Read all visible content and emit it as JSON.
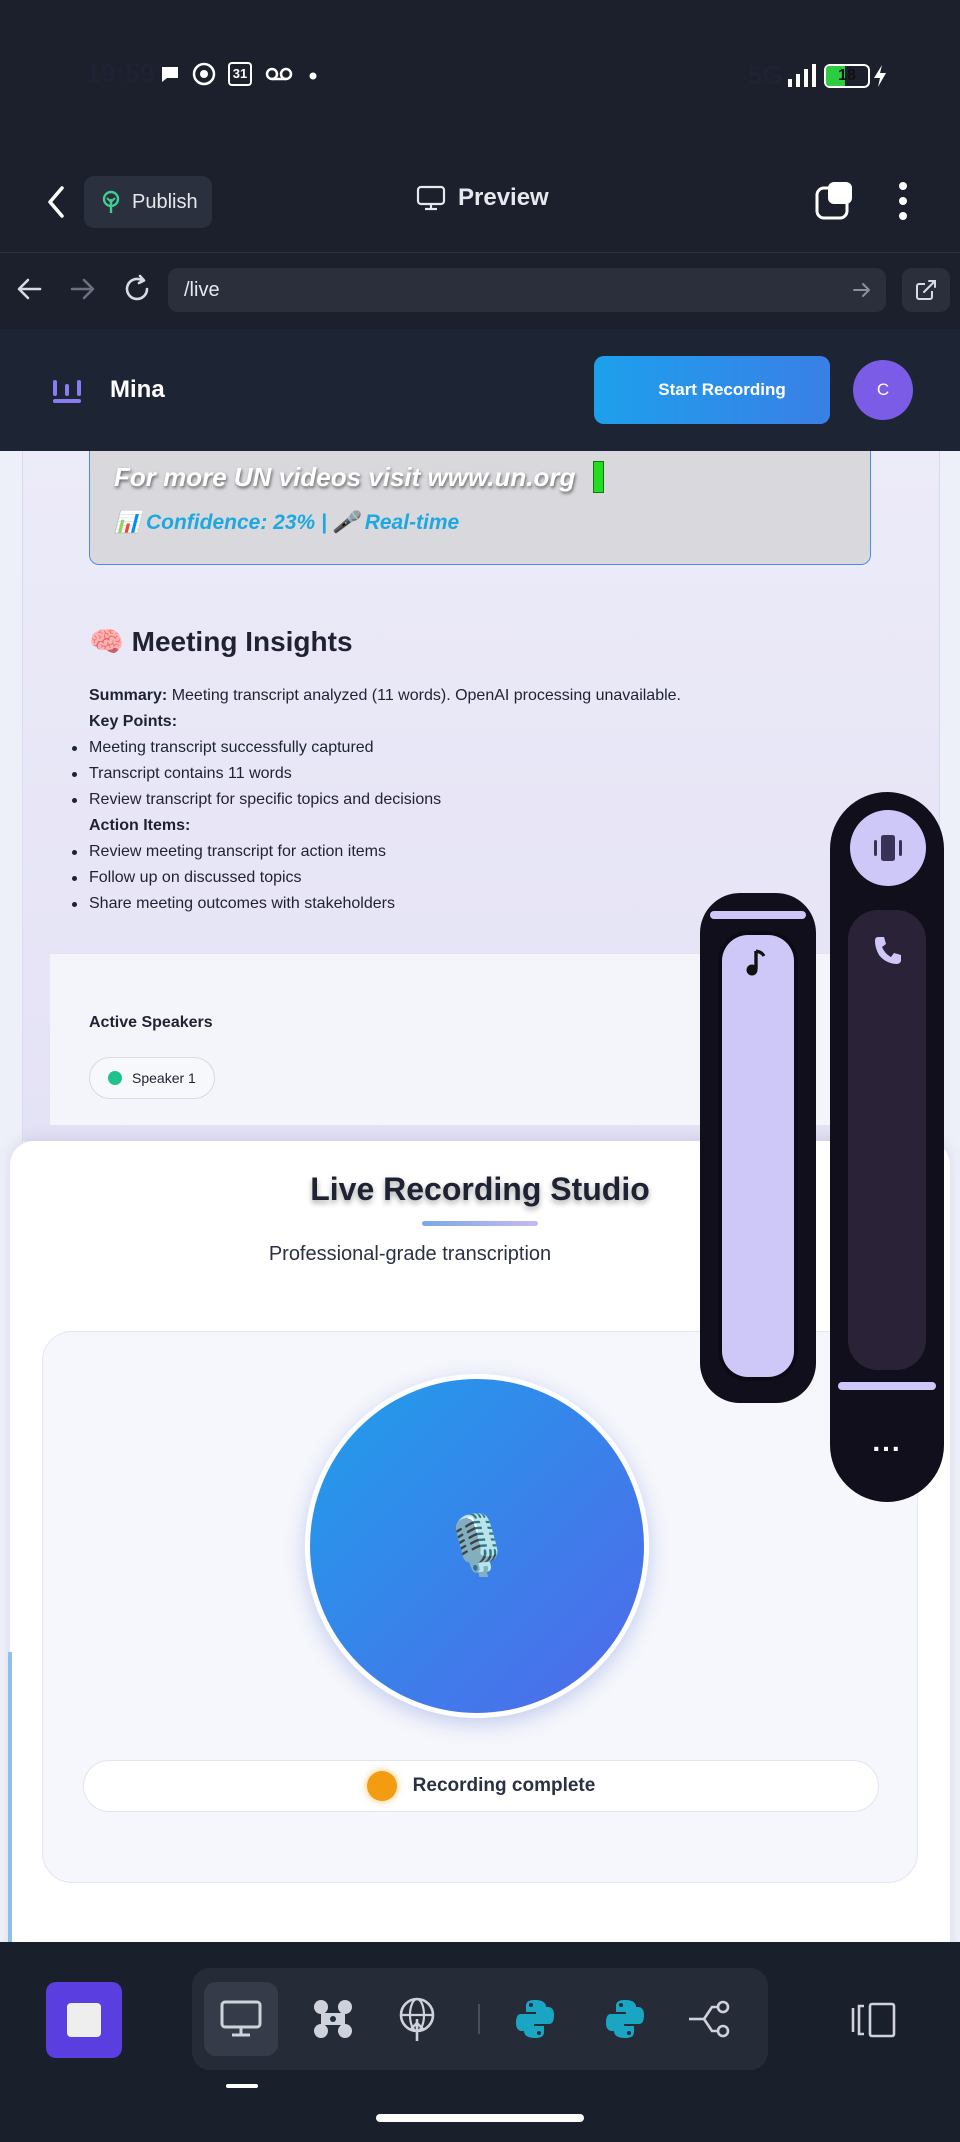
{
  "status_bar": {
    "time": "19:59",
    "network": "5G",
    "battery": "18",
    "icons": [
      "chat-icon",
      "soccer-icon",
      "calendar-icon",
      "voicemail-icon",
      "dot-icon",
      "signal-icon",
      "charging-icon"
    ],
    "calendar_day": "31"
  },
  "app_toolbar": {
    "publish_label": "Publish",
    "preview_label": "Preview"
  },
  "browser": {
    "url": "/live"
  },
  "header": {
    "brand": "Mina",
    "start_recording_label": "Start Recording",
    "avatar_initial": "C"
  },
  "transcript": {
    "current_line": "For more UN videos visit www.un.org",
    "confidence_text": "📊 Confidence: 23% | 🎤 Real-time"
  },
  "insights": {
    "title": "🧠 Meeting Insights",
    "summary_label": "Summary:",
    "summary_text": " Meeting transcript analyzed (11 words). OpenAI processing unavailable.",
    "key_points_label": "Key Points:",
    "key_points": [
      "Meeting transcript successfully captured",
      "Transcript contains 11 words",
      "Review transcript for specific topics and decisions"
    ],
    "action_items_label": "Action Items:",
    "action_items": [
      "Review meeting transcript for action items",
      "Follow up on discussed topics",
      "Share meeting outcomes with stakeholders"
    ]
  },
  "speakers": {
    "title": "Active Speakers",
    "list": [
      "Speaker 1"
    ]
  },
  "studio": {
    "title": "Live Recording Studio",
    "subtitle": "Professional-grade transcription",
    "mic_icon": "🎙️",
    "status_text": "Recording complete"
  },
  "volume_panel": {
    "music_level": 1.0,
    "call_level": 0.0,
    "more": "..."
  },
  "colors": {
    "accent_blue": "#1da0ec",
    "accent_purple": "#5b3ee0",
    "status_orange": "#f39c12",
    "speaker_green": "#1ec28b"
  }
}
